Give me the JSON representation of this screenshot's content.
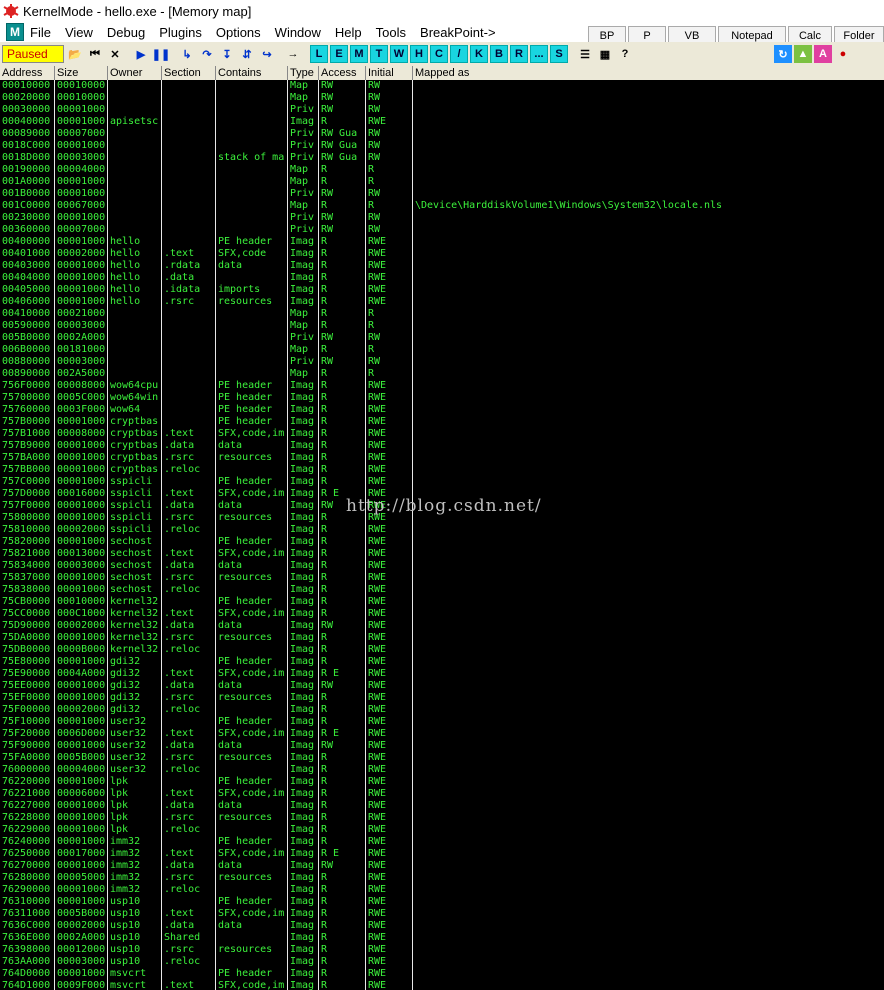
{
  "window": {
    "title": "KernelMode - hello.exe - [Memory map]"
  },
  "menu": {
    "logo": "M",
    "items": [
      "File",
      "View",
      "Debug",
      "Plugins",
      "Options",
      "Window",
      "Help",
      "Tools",
      "BreakPoint->"
    ]
  },
  "right_buttons": [
    "BP",
    "P",
    "VB",
    "Notepad",
    "Calc",
    "Folder"
  ],
  "toolbar": {
    "status": "Paused",
    "letter_buttons": [
      "L",
      "E",
      "M",
      "T",
      "W",
      "H",
      "C",
      "/",
      "K",
      "B",
      "R",
      "...",
      "S"
    ]
  },
  "columns": [
    "Address",
    "Size",
    "Owner",
    "Section",
    "Contains",
    "Type",
    "Access",
    "Initial",
    "Mapped as"
  ],
  "watermark": "http://blog.csdn.net/",
  "rows": [
    [
      "00010000",
      "00010000",
      "",
      "",
      "",
      "Map",
      "RW",
      "RW",
      ""
    ],
    [
      "00020000",
      "00010000",
      "",
      "",
      "",
      "Map",
      "RW",
      "RW",
      ""
    ],
    [
      "00030000",
      "00001000",
      "",
      "",
      "",
      "Priv",
      "RW",
      "RW",
      ""
    ],
    [
      "00040000",
      "00001000",
      "apisetsc",
      "",
      "",
      "Imag",
      "R",
      "RWE",
      ""
    ],
    [
      "00089000",
      "00007000",
      "",
      "",
      "",
      "Priv",
      "RW  Gua",
      "RW",
      ""
    ],
    [
      "0018C000",
      "00001000",
      "",
      "",
      "",
      "Priv",
      "RW  Gua",
      "RW",
      ""
    ],
    [
      "0018D000",
      "00003000",
      "",
      "",
      "stack of ma",
      "Priv",
      "RW  Gua",
      "RW",
      ""
    ],
    [
      "00190000",
      "00004000",
      "",
      "",
      "",
      "Map",
      "R",
      "R",
      ""
    ],
    [
      "001A0000",
      "00001000",
      "",
      "",
      "",
      "Map",
      "R",
      "R",
      ""
    ],
    [
      "001B0000",
      "00001000",
      "",
      "",
      "",
      "Priv",
      "RW",
      "RW",
      ""
    ],
    [
      "001C0000",
      "00067000",
      "",
      "",
      "",
      "Map",
      "R",
      "R",
      "\\Device\\HarddiskVolume1\\Windows\\System32\\locale.nls"
    ],
    [
      "00230000",
      "00001000",
      "",
      "",
      "",
      "Priv",
      "RW",
      "RW",
      ""
    ],
    [
      "00360000",
      "00007000",
      "",
      "",
      "",
      "Priv",
      "RW",
      "RW",
      ""
    ],
    [
      "00400000",
      "00001000",
      "hello",
      "",
      "PE header",
      "Imag",
      "R",
      "RWE",
      ""
    ],
    [
      "00401000",
      "00002000",
      "hello",
      ".text",
      "SFX,code",
      "Imag",
      "R",
      "RWE",
      ""
    ],
    [
      "00403000",
      "00001000",
      "hello",
      ".rdata",
      "data",
      "Imag",
      "R",
      "RWE",
      ""
    ],
    [
      "00404000",
      "00001000",
      "hello",
      ".data",
      "",
      "Imag",
      "R",
      "RWE",
      ""
    ],
    [
      "00405000",
      "00001000",
      "hello",
      ".idata",
      "imports",
      "Imag",
      "R",
      "RWE",
      ""
    ],
    [
      "00406000",
      "00001000",
      "hello",
      ".rsrc",
      "resources",
      "Imag",
      "R",
      "RWE",
      ""
    ],
    [
      "00410000",
      "00021000",
      "",
      "",
      "",
      "Map",
      "R",
      "R",
      ""
    ],
    [
      "00590000",
      "00003000",
      "",
      "",
      "",
      "Map",
      "R",
      "R",
      ""
    ],
    [
      "005B0000",
      "0002A000",
      "",
      "",
      "",
      "Priv",
      "RW",
      "RW",
      ""
    ],
    [
      "006B0000",
      "00181000",
      "",
      "",
      "",
      "Map",
      "R",
      "R",
      ""
    ],
    [
      "00880000",
      "00003000",
      "",
      "",
      "",
      "Priv",
      "RW",
      "RW",
      ""
    ],
    [
      "00890000",
      "002A5000",
      "",
      "",
      "",
      "Map",
      "R",
      "R",
      ""
    ],
    [
      "756F0000",
      "00008000",
      "wow64cpu",
      "",
      "PE header",
      "Imag",
      "R",
      "RWE",
      ""
    ],
    [
      "75700000",
      "0005C000",
      "wow64win",
      "",
      "PE header",
      "Imag",
      "R",
      "RWE",
      ""
    ],
    [
      "75760000",
      "0003F000",
      "wow64",
      "",
      "PE header",
      "Imag",
      "R",
      "RWE",
      ""
    ],
    [
      "757B0000",
      "00001000",
      "cryptbas",
      "",
      "PE header",
      "Imag",
      "R",
      "RWE",
      ""
    ],
    [
      "757B1000",
      "00008000",
      "cryptbas",
      ".text",
      "SFX,code,im",
      "Imag",
      "R",
      "RWE",
      ""
    ],
    [
      "757B9000",
      "00001000",
      "cryptbas",
      ".data",
      "data",
      "Imag",
      "R",
      "RWE",
      ""
    ],
    [
      "757BA000",
      "00001000",
      "cryptbas",
      ".rsrc",
      "resources",
      "Imag",
      "R",
      "RWE",
      ""
    ],
    [
      "757BB000",
      "00001000",
      "cryptbas",
      ".reloc",
      "",
      "Imag",
      "R",
      "RWE",
      ""
    ],
    [
      "757C0000",
      "00001000",
      "sspicli",
      "",
      "PE header",
      "Imag",
      "R",
      "RWE",
      ""
    ],
    [
      "757D0000",
      "00016000",
      "sspicli",
      ".text",
      "SFX,code,im",
      "Imag",
      "R E",
      "RWE",
      ""
    ],
    [
      "757F0000",
      "00001000",
      "sspicli",
      ".data",
      "data",
      "Imag",
      "RW",
      "RWE",
      ""
    ],
    [
      "75800000",
      "00001000",
      "sspicli",
      ".rsrc",
      "resources",
      "Imag",
      "R",
      "RWE",
      ""
    ],
    [
      "75810000",
      "00002000",
      "sspicli",
      ".reloc",
      "",
      "Imag",
      "R",
      "RWE",
      ""
    ],
    [
      "75820000",
      "00001000",
      "sechost",
      "",
      "PE header",
      "Imag",
      "R",
      "RWE",
      ""
    ],
    [
      "75821000",
      "00013000",
      "sechost",
      ".text",
      "SFX,code,im",
      "Imag",
      "R",
      "RWE",
      ""
    ],
    [
      "75834000",
      "00003000",
      "sechost",
      ".data",
      "data",
      "Imag",
      "R",
      "RWE",
      ""
    ],
    [
      "75837000",
      "00001000",
      "sechost",
      ".rsrc",
      "resources",
      "Imag",
      "R",
      "RWE",
      ""
    ],
    [
      "75838000",
      "00001000",
      "sechost",
      ".reloc",
      "",
      "Imag",
      "R",
      "RWE",
      ""
    ],
    [
      "75CB0000",
      "00010000",
      "kernel32",
      "",
      "PE header",
      "Imag",
      "R",
      "RWE",
      ""
    ],
    [
      "75CC0000",
      "000C1000",
      "kernel32",
      ".text",
      "SFX,code,im",
      "Imag",
      "R",
      "RWE",
      ""
    ],
    [
      "75D90000",
      "00002000",
      "kernel32",
      ".data",
      "data",
      "Imag",
      "RW",
      "RWE",
      ""
    ],
    [
      "75DA0000",
      "00001000",
      "kernel32",
      ".rsrc",
      "resources",
      "Imag",
      "R",
      "RWE",
      ""
    ],
    [
      "75DB0000",
      "0000B000",
      "kernel32",
      ".reloc",
      "",
      "Imag",
      "R",
      "RWE",
      ""
    ],
    [
      "75E80000",
      "00001000",
      "gdi32",
      "",
      "PE header",
      "Imag",
      "R",
      "RWE",
      ""
    ],
    [
      "75E90000",
      "0004A000",
      "gdi32",
      ".text",
      "SFX,code,im",
      "Imag",
      "R E",
      "RWE",
      ""
    ],
    [
      "75EE0000",
      "00001000",
      "gdi32",
      ".data",
      "data",
      "Imag",
      "RW",
      "RWE",
      ""
    ],
    [
      "75EF0000",
      "00001000",
      "gdi32",
      ".rsrc",
      "resources",
      "Imag",
      "R",
      "RWE",
      ""
    ],
    [
      "75F00000",
      "00002000",
      "gdi32",
      ".reloc",
      "",
      "Imag",
      "R",
      "RWE",
      ""
    ],
    [
      "75F10000",
      "00001000",
      "user32",
      "",
      "PE header",
      "Imag",
      "R",
      "RWE",
      ""
    ],
    [
      "75F20000",
      "0006D000",
      "user32",
      ".text",
      "SFX,code,im",
      "Imag",
      "R E",
      "RWE",
      ""
    ],
    [
      "75F90000",
      "00001000",
      "user32",
      ".data",
      "data",
      "Imag",
      "RW",
      "RWE",
      ""
    ],
    [
      "75FA0000",
      "0005B000",
      "user32",
      ".rsrc",
      "resources",
      "Imag",
      "R",
      "RWE",
      ""
    ],
    [
      "76000000",
      "00004000",
      "user32",
      ".reloc",
      "",
      "Imag",
      "R",
      "RWE",
      ""
    ],
    [
      "76220000",
      "00001000",
      "lpk",
      "",
      "PE header",
      "Imag",
      "R",
      "RWE",
      ""
    ],
    [
      "76221000",
      "00006000",
      "lpk",
      ".text",
      "SFX,code,im",
      "Imag",
      "R",
      "RWE",
      ""
    ],
    [
      "76227000",
      "00001000",
      "lpk",
      ".data",
      "data",
      "Imag",
      "R",
      "RWE",
      ""
    ],
    [
      "76228000",
      "00001000",
      "lpk",
      ".rsrc",
      "resources",
      "Imag",
      "R",
      "RWE",
      ""
    ],
    [
      "76229000",
      "00001000",
      "lpk",
      ".reloc",
      "",
      "Imag",
      "R",
      "RWE",
      ""
    ],
    [
      "76240000",
      "00001000",
      "imm32",
      "",
      "PE header",
      "Imag",
      "R",
      "RWE",
      ""
    ],
    [
      "76250000",
      "00017000",
      "imm32",
      ".text",
      "SFX,code,im",
      "Imag",
      "R E",
      "RWE",
      ""
    ],
    [
      "76270000",
      "00001000",
      "imm32",
      ".data",
      "data",
      "Imag",
      "RW",
      "RWE",
      ""
    ],
    [
      "76280000",
      "00005000",
      "imm32",
      ".rsrc",
      "resources",
      "Imag",
      "R",
      "RWE",
      ""
    ],
    [
      "76290000",
      "00001000",
      "imm32",
      ".reloc",
      "",
      "Imag",
      "R",
      "RWE",
      ""
    ],
    [
      "76310000",
      "00001000",
      "usp10",
      "",
      "PE header",
      "Imag",
      "R",
      "RWE",
      ""
    ],
    [
      "76311000",
      "0005B000",
      "usp10",
      ".text",
      "SFX,code,im",
      "Imag",
      "R",
      "RWE",
      ""
    ],
    [
      "7636C000",
      "00002000",
      "usp10",
      ".data",
      "data",
      "Imag",
      "R",
      "RWE",
      ""
    ],
    [
      "7636E000",
      "0002A000",
      "usp10",
      "Shared",
      "",
      "Imag",
      "R",
      "RWE",
      ""
    ],
    [
      "76398000",
      "00012000",
      "usp10",
      ".rsrc",
      "resources",
      "Imag",
      "R",
      "RWE",
      ""
    ],
    [
      "763AA000",
      "00003000",
      "usp10",
      ".reloc",
      "",
      "Imag",
      "R",
      "RWE",
      ""
    ],
    [
      "764D0000",
      "00001000",
      "msvcrt",
      "",
      "PE header",
      "Imag",
      "R",
      "RWE",
      ""
    ],
    [
      "764D1000",
      "0009F000",
      "msvcrt",
      ".text",
      "SFX,code,im",
      "Imag",
      "R",
      "RWE",
      ""
    ]
  ]
}
